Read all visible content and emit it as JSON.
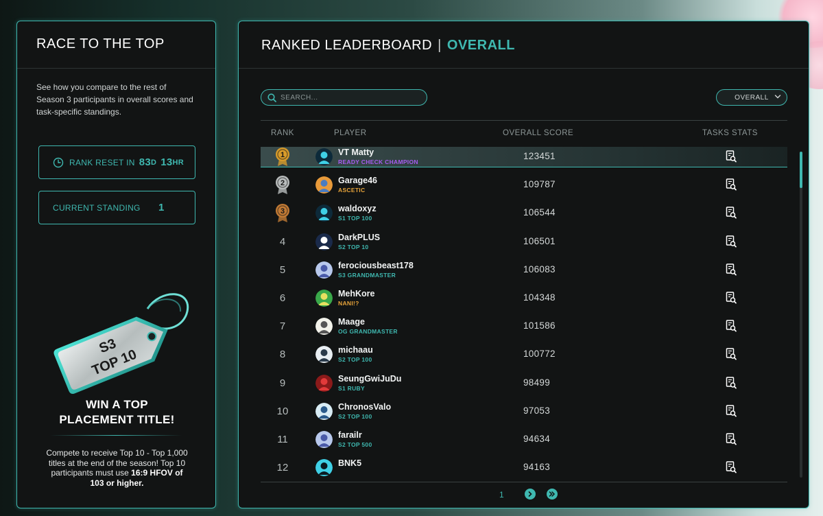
{
  "colors": {
    "accent": "#3fb8b0",
    "gold": "#d89b2a",
    "silver": "#b8bcbc",
    "bronze": "#c27a34",
    "purple": "#a75cf0",
    "teal_title": "#3fb8b0",
    "orange_title": "#e8a43a"
  },
  "left": {
    "title": "RACE TO THE TOP",
    "description": "See how you compare to the rest of Season 3 participants in overall scores and task-specific standings.",
    "reset": {
      "label": "RANK RESET IN",
      "days": "83",
      "days_unit": "D",
      "hours": "13",
      "hours_unit": "HR",
      "icon": "clock-icon"
    },
    "standing": {
      "label": "CURRENT STANDING",
      "value": "1"
    },
    "tag": {
      "line1": "S3",
      "line2": "TOP 10"
    },
    "win_title_1": "WIN A TOP",
    "win_title_2": "PLACEMENT TITLE!",
    "win_desc_1": "Compete to receive Top 10 - Top 1,000 titles at the end of the season! Top 10 participants must use ",
    "win_desc_bold": "16:9 HFOV of 103 or higher."
  },
  "right": {
    "title": "RANKED LEADERBOARD",
    "separator": "|",
    "title_accent": "OVERALL",
    "search_placeholder": "SEARCH...",
    "filter_value": "OVERALL",
    "columns": {
      "rank": "RANK",
      "player": "PLAYER",
      "score": "OVERALL SCORE",
      "stats": "TASKS STATS"
    },
    "rows": [
      {
        "rank": "1",
        "medal": "gold",
        "name": "VT Matty",
        "title": "READY CHECK CHAMPION",
        "title_color": "#a75cf0",
        "score": "123451",
        "avatar": "visor-avatar"
      },
      {
        "rank": "2",
        "medal": "silver",
        "name": "Garage46",
        "title": "ASCETIC",
        "title_color": "#e8a43a",
        "score": "109787",
        "avatar": "character-avatar"
      },
      {
        "rank": "3",
        "medal": "bronze",
        "name": "waldoxyz",
        "title": "S1 TOP 100",
        "title_color": "#3fb8b0",
        "score": "106544",
        "avatar": "visor-avatar"
      },
      {
        "rank": "4",
        "medal": "",
        "name": "DarkPLUS",
        "title": "S2 TOP 10",
        "title_color": "#3fb8b0",
        "score": "106501",
        "avatar": "bird-avatar"
      },
      {
        "rank": "5",
        "medal": "",
        "name": "ferociousbeast178",
        "title": "S3 GRANDMASTER",
        "title_color": "#3fb8b0",
        "score": "106083",
        "avatar": "anime-avatar"
      },
      {
        "rank": "6",
        "medal": "",
        "name": "MehKore",
        "title": "NANI!?",
        "title_color": "#e8a43a",
        "score": "104348",
        "avatar": "green-avatar"
      },
      {
        "rank": "7",
        "medal": "",
        "name": "Maage",
        "title": "OG GRANDMASTER",
        "title_color": "#3fb8b0",
        "score": "101586",
        "avatar": "sketch-avatar"
      },
      {
        "rank": "8",
        "medal": "",
        "name": "michaau",
        "title": "S2 TOP 100",
        "title_color": "#3fb8b0",
        "score": "100772",
        "avatar": "cat-avatar"
      },
      {
        "rank": "9",
        "medal": "",
        "name": "SeungGwiJuDu",
        "title": "S1 RUBY",
        "title_color": "#3fb8b0",
        "score": "98499",
        "avatar": "red-avatar"
      },
      {
        "rank": "10",
        "medal": "",
        "name": "ChronosValo",
        "title": "S2 TOP 100",
        "title_color": "#3fb8b0",
        "score": "97053",
        "avatar": "figure-avatar"
      },
      {
        "rank": "11",
        "medal": "",
        "name": "farailr",
        "title": "S2 TOP 500",
        "title_color": "#3fb8b0",
        "score": "94634",
        "avatar": "anime-avatar"
      },
      {
        "rank": "12",
        "medal": "",
        "name": "BNK5",
        "title": "",
        "title_color": "#3fb8b0",
        "score": "94163",
        "avatar": "silhouette-avatar"
      }
    ],
    "pagination": {
      "current": "1",
      "next_icon": "chevron-right-icon",
      "last_icon": "double-chevron-right-icon"
    }
  }
}
